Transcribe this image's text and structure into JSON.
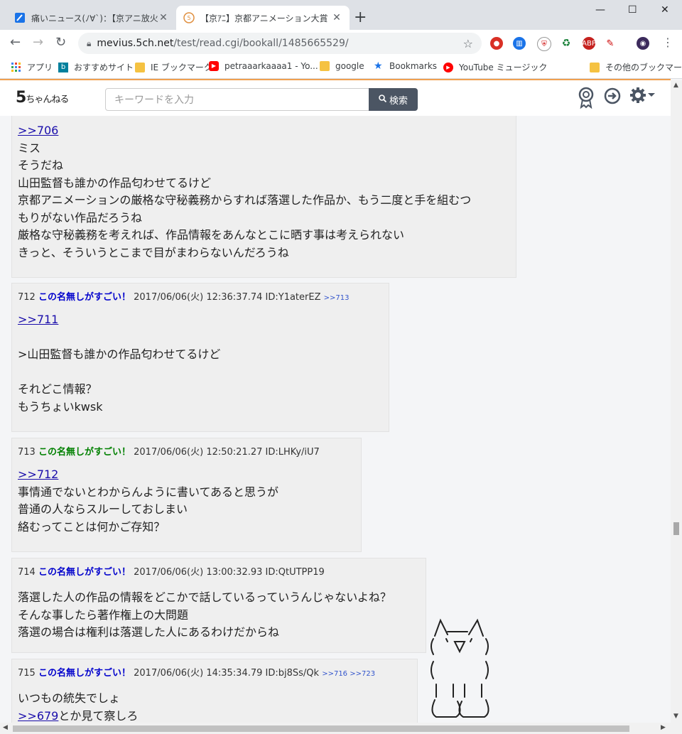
{
  "browser": {
    "tabs": [
      {
        "title": "痛いニュース(ﾉ∀`)：【京アニ放火】書",
        "active": false
      },
      {
        "title": "【京ｱﾆ】京都アニメーション大賞【KAI",
        "active": true
      }
    ],
    "url_domain": "mevius.5ch.net",
    "url_path": "/test/read.cgi/bookall/1485665529/",
    "extension_badge": "18",
    "bookmarks": [
      {
        "label": "アプリ",
        "icon": "apps-grid-icon"
      },
      {
        "label": "おすすめサイト",
        "icon": "bing-icon"
      },
      {
        "label": "IE ブックマーク",
        "icon": "folder-icon"
      },
      {
        "label": "petraaarkaaaa1 - Yo...",
        "icon": "youtube-icon"
      },
      {
        "label": "google",
        "icon": "folder-icon"
      },
      {
        "label": "Bookmarks",
        "icon": "star-icon"
      },
      {
        "label": "YouTube ミュージック",
        "icon": "youtube-music-icon"
      },
      {
        "label": "その他のブックマーク",
        "icon": "folder-icon"
      }
    ]
  },
  "site": {
    "logo_main": "5",
    "logo_sub": "ちゃんねる",
    "search_placeholder": "キーワードを入力",
    "search_button": "検索"
  },
  "posts": [
    {
      "partial": true,
      "lines": [
        {
          "anchor": ">>706"
        },
        {
          "text": "ミス"
        },
        {
          "text": "そうだね"
        },
        {
          "text": "山田監督も誰かの作品匂わせてるけど"
        },
        {
          "text": "京都アニメーションの厳格な守秘義務からすれば落選した作品か、もう二度と手を組むつ"
        },
        {
          "text": "もりがない作品だろうね"
        },
        {
          "text": "厳格な守秘義務を考えれば、作品情報をあんなとこに晒す事は考えられない"
        },
        {
          "text": "きっと、そういうとこまで目がまわらないんだろうね"
        }
      ]
    },
    {
      "number": "712",
      "name": "この名無しがすごい！",
      "name_color": "blue",
      "date": "2017/06/06(火) 12:36:37.74",
      "id": "ID:Y1aterEZ",
      "refs": ">>713",
      "lines": [
        {
          "anchor": ">>711"
        },
        {
          "text": ""
        },
        {
          "text": ">山田監督も誰かの作品匂わせてるけど"
        },
        {
          "text": ""
        },
        {
          "text": "それどこ情報？"
        },
        {
          "text": "もうちょいkwsk"
        }
      ]
    },
    {
      "number": "713",
      "name": "この名無しがすごい！",
      "name_color": "green",
      "date": "2017/06/06(火) 12:50:21.27",
      "id": "ID:LHKy/iU7",
      "refs": "",
      "lines": [
        {
          "anchor": ">>712"
        },
        {
          "text": "事情通でないとわからんように書いてあると思うが"
        },
        {
          "text": "普通の人ならスルーしておしまい"
        },
        {
          "text": "絡むってことは何かご存知？"
        }
      ]
    },
    {
      "number": "714",
      "name": "この名無しがすごい！",
      "name_color": "blue",
      "date": "2017/06/06(火) 13:00:32.93",
      "id": "ID:QtUTPP19",
      "refs": "",
      "lines": [
        {
          "text": "落選した人の作品の情報をどこかで話しているっていうんじゃないよね？"
        },
        {
          "text": "そんな事したら著作権上の大問題"
        },
        {
          "text": "落選の場合は権利は落選した人にあるわけだからね"
        }
      ]
    },
    {
      "number": "715",
      "name": "この名無しがすごい！",
      "name_color": "blue",
      "date": "2017/06/06(火) 14:35:34.79",
      "id": "ID:bj8Ss/Qk",
      "refs": ">>716 >>723",
      "lines": [
        {
          "text": "いつもの統失でしょ"
        },
        {
          "anchor": ">>679",
          "text": "とか見て察しろ"
        }
      ]
    }
  ],
  "colors": {
    "name_blue": "#0000cc",
    "name_green": "#008000",
    "link": "#1a0dab",
    "accent_orange": "#f0a050"
  }
}
